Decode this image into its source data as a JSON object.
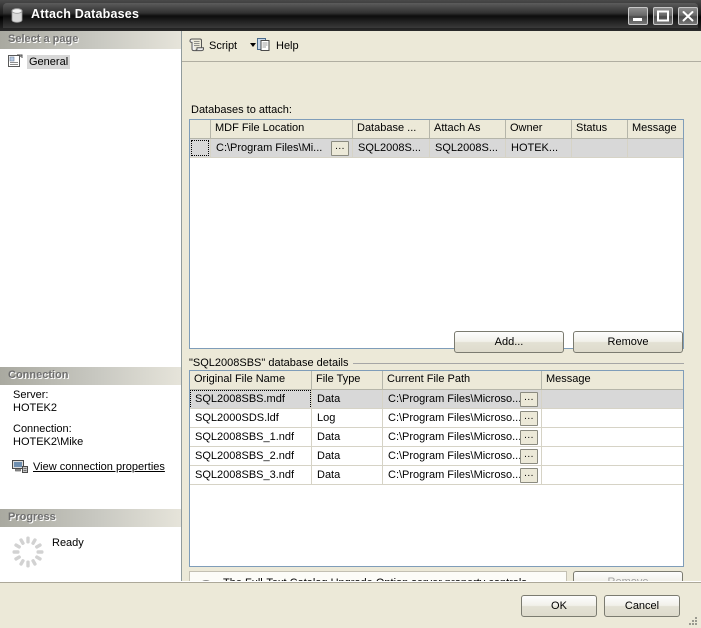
{
  "window": {
    "title": "Attach Databases",
    "icon": "database-icon",
    "buttons": {
      "minimize": "minimize-icon",
      "maximize": "maximize-icon",
      "close": "close-icon"
    }
  },
  "sidebar": {
    "select_a_page_header": "Select a page",
    "pages": [
      {
        "label": "General",
        "icon": "page-icon",
        "selected": true
      }
    ],
    "connection": {
      "header": "Connection",
      "server_label": "Server:",
      "server_value": "HOTEK2",
      "connection_label": "Connection:",
      "connection_value": "HOTEK2\\Mike",
      "view_properties_link": "View connection properties",
      "view_properties_icon": "server-properties-icon"
    },
    "progress": {
      "header": "Progress",
      "status": "Ready",
      "spinner_icon": "progress-spinner-icon"
    }
  },
  "toolbar": {
    "script_label": "Script",
    "script_icon": "script-icon",
    "script_dropdown_icon": "chevron-down-icon",
    "help_label": "Help",
    "help_icon": "help-icon"
  },
  "main": {
    "attach_grid": {
      "label": "Databases to attach:",
      "columns": [
        "",
        "MDF File Location",
        "Database ...",
        "Attach As",
        "Owner",
        "Status",
        "Message"
      ],
      "rows": [
        {
          "selected": true,
          "mdf_file_location": "C:\\Program Files\\Mi...",
          "browse_button": "...",
          "database_name": "SQL2008S...",
          "attach_as": "SQL2008S...",
          "owner": "HOTEK...",
          "status": "",
          "message": ""
        }
      ]
    },
    "add_button": "Add...",
    "remove_button_top": "Remove",
    "details_group_title": "\"SQL2008SBS\" database details",
    "details_grid": {
      "columns": [
        "Original File Name",
        "File Type",
        "Current File Path",
        "Message"
      ],
      "rows": [
        {
          "selected": true,
          "original_file_name": "SQL2008SBS.mdf",
          "file_type": "Data",
          "current_file_path": "C:\\Program Files\\Microso...",
          "browse_button": "...",
          "message": ""
        },
        {
          "selected": false,
          "original_file_name": "SQL2000SDS.ldf",
          "file_type": "Log",
          "current_file_path": "C:\\Program Files\\Microso...",
          "browse_button": "...",
          "message": ""
        },
        {
          "selected": false,
          "original_file_name": "SQL2008SBS_1.ndf",
          "file_type": "Data",
          "current_file_path": "C:\\Program Files\\Microso...",
          "browse_button": "...",
          "message": ""
        },
        {
          "selected": false,
          "original_file_name": "SQL2008SBS_2.ndf",
          "file_type": "Data",
          "current_file_path": "C:\\Program Files\\Microso...",
          "browse_button": "...",
          "message": ""
        },
        {
          "selected": false,
          "original_file_name": "SQL2008SBS_3.ndf",
          "file_type": "Data",
          "current_file_path": "C:\\Program Files\\Microso...",
          "browse_button": "...",
          "message": ""
        }
      ]
    },
    "info_bar": {
      "icon": "info-icon",
      "text": "The Full-Text Catalog Upgrade Option server property controls whether full-text indexes are imported, rebuilt, or reset."
    },
    "remove_button_bottom": "Remove"
  },
  "footer": {
    "ok_label": "OK",
    "cancel_label": "Cancel",
    "resize_grip_icon": "resize-grip-icon"
  },
  "colors": {
    "dialog_background": "#ece9d8",
    "grid_background": "#ffffff",
    "grid_border": "#7f9db9",
    "selection": "#d8d8d8",
    "panel_header_text": "#6f6f6f",
    "title_text": "#ffffff"
  }
}
